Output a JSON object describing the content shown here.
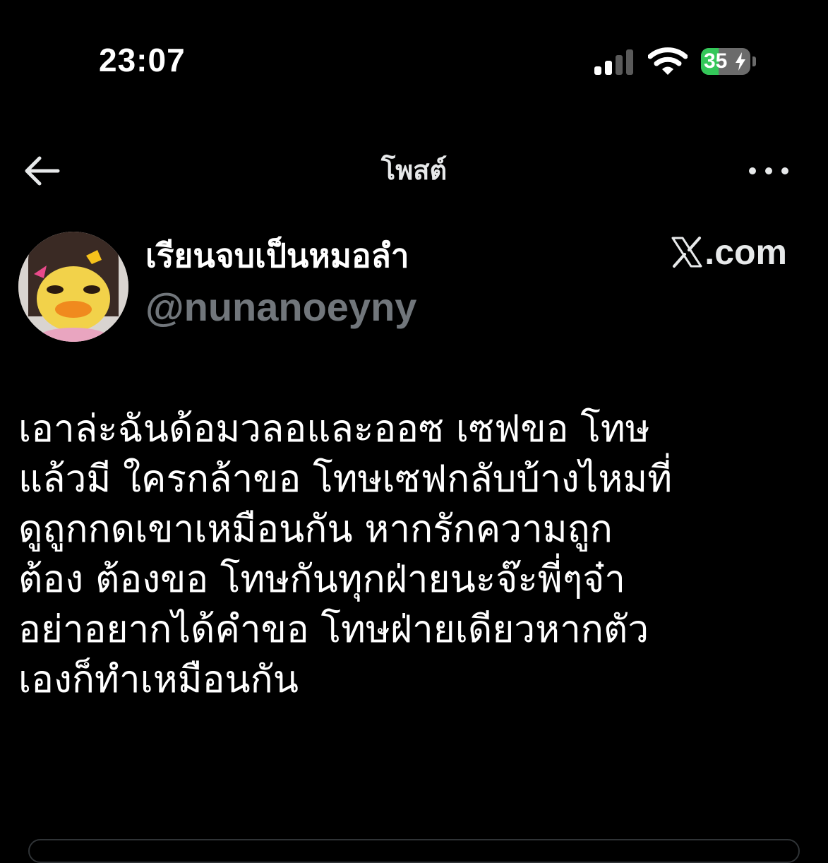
{
  "status_bar": {
    "time": "23:07",
    "battery_level": "35",
    "battery_fraction": 0.35,
    "signal_bars_active": 2,
    "signal_bars_total": 4,
    "icons": [
      "cellular-signal-icon",
      "wifi-icon",
      "battery-icon",
      "charging-bolt-icon"
    ],
    "colors": {
      "battery_fill": "#34c759",
      "battery_empty": "#6b6b6b",
      "signal_active": "#ffffff",
      "signal_inactive": "#5a5a5a"
    }
  },
  "header": {
    "title": "โพสต์",
    "back_icon": "arrow-left-icon",
    "more_icon": "more-horizontal-icon"
  },
  "author": {
    "display_name": "เรียนจบเป็นหมอลำ",
    "username": "@nunanoeyny",
    "avatar_icon": "avatar-image"
  },
  "watermark": {
    "domain_text": ".com",
    "logo_icon": "x-logo-icon"
  },
  "post": {
    "text": "เอาล่ะฉันด้อมวลอและออซ เซฟขอ โทษ\nแล้วมี ใครกล้าขอ โทษเซฟกลับบ้างไหมที่\nดูถูกกดเขาเหมือนกัน หากรักความถูก\nต้อง ต้องขอ โทษกันทุกฝ่ายนะจ๊ะพี่ๆจ๋า\nอย่าอยากได้คำขอ โทษฝ่ายเดียวหากตัว\nเองก็ทำเหมือนกัน"
  },
  "theme": {
    "background": "#000000",
    "text_primary": "#e7e9ea",
    "text_secondary": "#71767b"
  }
}
